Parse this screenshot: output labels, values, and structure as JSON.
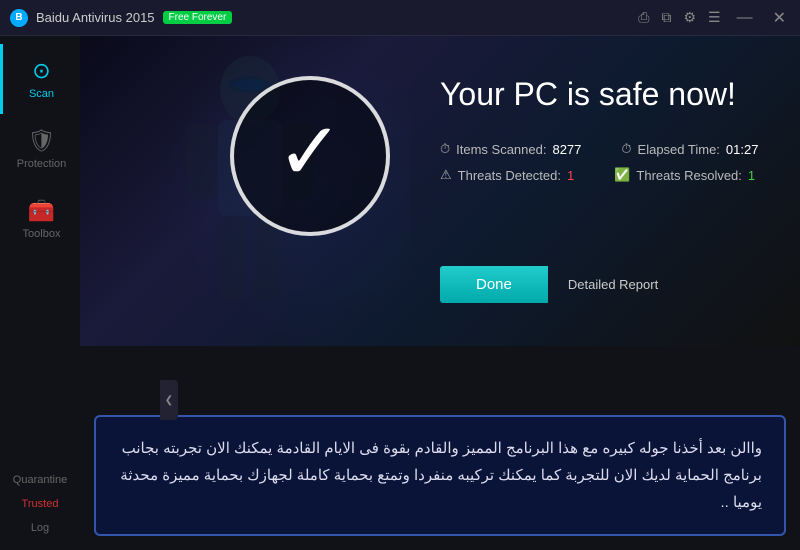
{
  "titlebar": {
    "logo_text": "B",
    "title": "Baidu Antivirus 2015",
    "badge": "Free Forever",
    "icons": [
      "share",
      "copy",
      "gear",
      "menu"
    ],
    "min_label": "—",
    "close_label": "✕"
  },
  "sidebar": {
    "items": [
      {
        "id": "scan",
        "label": "Scan",
        "icon": "🔍",
        "active": true
      },
      {
        "id": "protection",
        "label": "Protection",
        "icon": "🛡",
        "active": false
      },
      {
        "id": "toolbox",
        "label": "Toolbox",
        "icon": "🧰",
        "active": false
      }
    ],
    "bottom_links": [
      {
        "id": "quarantine",
        "label": "Quarantine",
        "red": false
      },
      {
        "id": "trusted",
        "label": "Trusted",
        "red": true
      },
      {
        "id": "log",
        "label": "Log",
        "red": false
      }
    ],
    "collapse_icon": "❮"
  },
  "hero": {
    "safe_title": "Your PC is safe now!",
    "stats": [
      {
        "icon": "🔍",
        "label": "Items Scanned:",
        "value": "8277",
        "color": "normal"
      },
      {
        "icon": "⏱",
        "label": "Elapsed Time:",
        "value": "01:27",
        "color": "normal"
      },
      {
        "icon": "⚠",
        "label": "Threats Detected:",
        "value": "1",
        "color": "red"
      },
      {
        "icon": "✅",
        "label": "Threats Resolved:",
        "value": "1",
        "color": "green"
      }
    ]
  },
  "actions": {
    "done_label": "Done",
    "report_label": "Detailed Report"
  },
  "arabic": {
    "text": "واالن بعد أخذنا جوله كبيره مع هذا البرنامج المميز والقادم بقوة فى الايام القادمة يمكنك الان تجربته بجانب برنامج الحماية لديك الان للتجربة كما يمكنك تركيبه منفردا وتمتع بحماية كاملة لجهازك بحماية مميزة محدثة يوميا .."
  }
}
